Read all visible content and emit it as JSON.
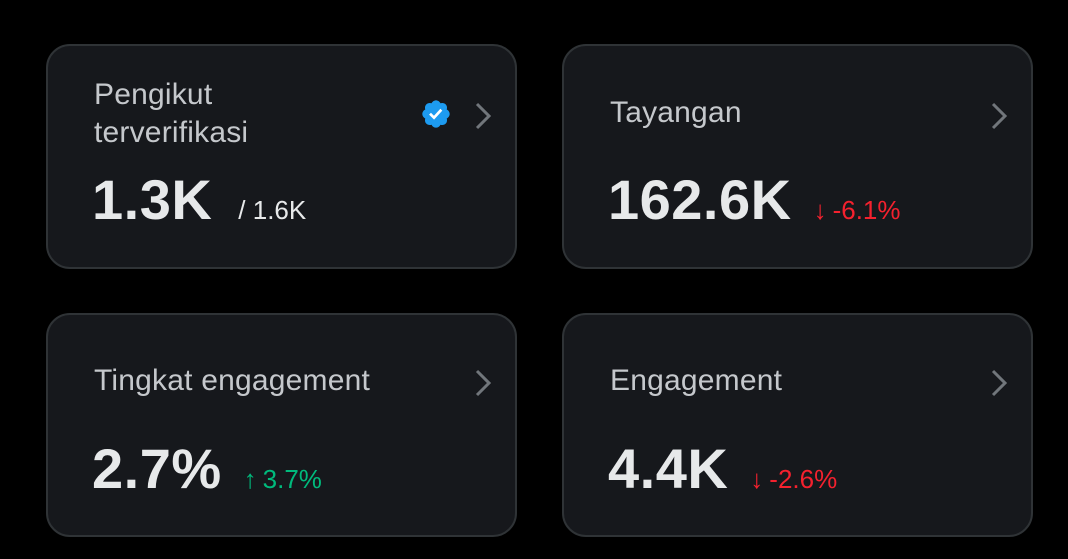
{
  "cards": [
    {
      "label": "Pengikut terverifikasi",
      "value": "1.3K",
      "sub": "/ 1.6K",
      "verified_icon": "verified-badge-icon",
      "chevron_icon": "chevron-right-icon"
    },
    {
      "label": "Tayangan",
      "value": "162.6K",
      "delta": {
        "arrow": "↓",
        "text": "-6.1%",
        "direction": "down"
      },
      "chevron_icon": "chevron-right-icon"
    },
    {
      "label": "Tingkat engagement",
      "value": "2.7%",
      "delta": {
        "arrow": "↑",
        "text": "3.7%",
        "direction": "up"
      },
      "chevron_icon": "chevron-right-icon"
    },
    {
      "label": "Engagement",
      "value": "4.4K",
      "delta": {
        "arrow": "↓",
        "text": "-2.6%",
        "direction": "down"
      },
      "chevron_icon": "chevron-right-icon"
    }
  ],
  "colors": {
    "background": "#000000",
    "card": "#16181c",
    "border": "#2f3336",
    "label": "#c5c8cc",
    "value": "#e7e9ea",
    "negative": "#f4212e",
    "positive": "#00ba7c",
    "verified": "#1d9bf0"
  }
}
